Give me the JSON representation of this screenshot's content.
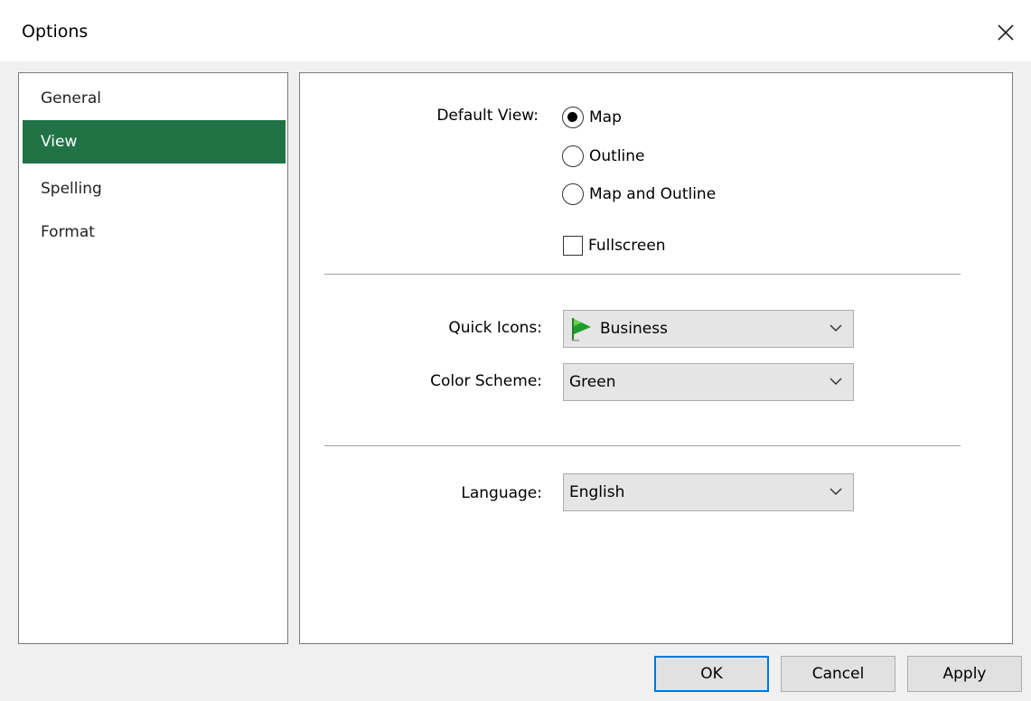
{
  "window": {
    "title": "Options"
  },
  "sidebar": {
    "items": [
      {
        "label": "General"
      },
      {
        "label": "View",
        "selected": true
      },
      {
        "label": "Spelling"
      },
      {
        "label": "Format"
      }
    ]
  },
  "view": {
    "default_view_label": "Default View:",
    "radio_options": [
      {
        "label": "Map",
        "checked": true
      },
      {
        "label": "Outline",
        "checked": false
      },
      {
        "label": "Map and Outline",
        "checked": false
      }
    ],
    "fullscreen": {
      "label": "Fullscreen",
      "checked": false
    },
    "quick_icons": {
      "label": "Quick Icons:",
      "value": "Business",
      "icon": "green-flag-icon"
    },
    "color_scheme": {
      "label": "Color Scheme:",
      "value": "Green"
    },
    "language": {
      "label": "Language:",
      "value": "English"
    }
  },
  "buttons": {
    "ok": "OK",
    "cancel": "Cancel",
    "apply": "Apply"
  },
  "colors": {
    "accent": "#217346",
    "default_button_border": "#0078d7"
  }
}
